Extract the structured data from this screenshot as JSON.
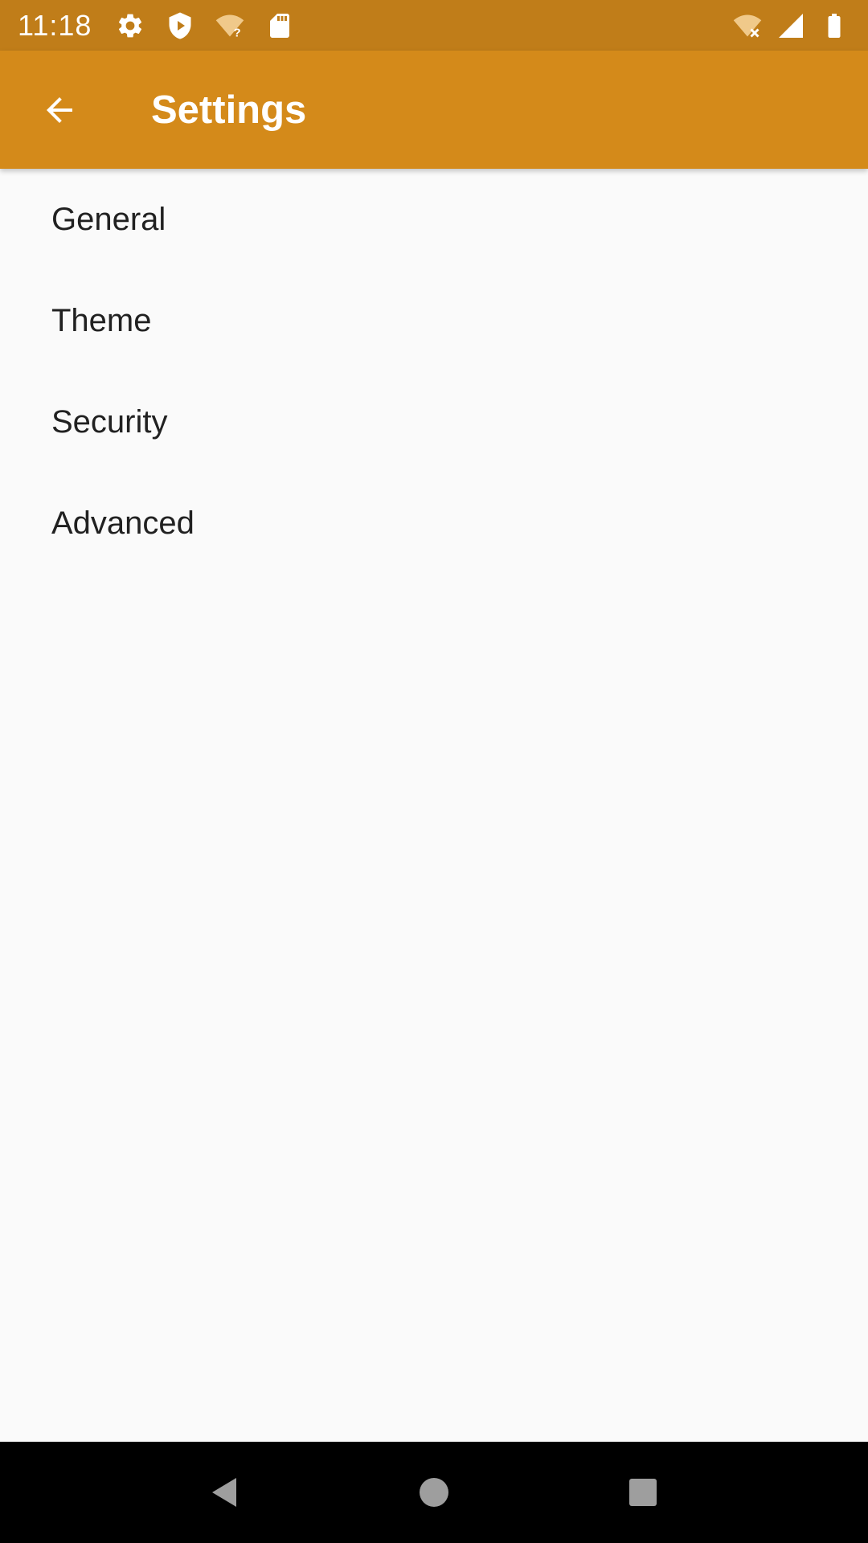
{
  "status_bar": {
    "time": "11:18",
    "left_icons": [
      "gear-icon",
      "shield-play-icon",
      "wifi-question-icon",
      "sd-card-icon"
    ],
    "right_icons": [
      "wifi-off-icon",
      "cell-signal-icon",
      "battery-icon"
    ]
  },
  "app_bar": {
    "title": "Settings",
    "back_icon": "arrow-left-icon"
  },
  "settings": {
    "items": [
      {
        "label": "General"
      },
      {
        "label": "Theme"
      },
      {
        "label": "Security"
      },
      {
        "label": "Advanced"
      }
    ]
  },
  "nav_bar": {
    "buttons": [
      "back-triangle-icon",
      "home-circle-icon",
      "recents-square-icon"
    ]
  },
  "colors": {
    "status_bar": "#c07d19",
    "app_bar": "#d48a1a",
    "background": "#fafafa",
    "text": "#212121"
  }
}
